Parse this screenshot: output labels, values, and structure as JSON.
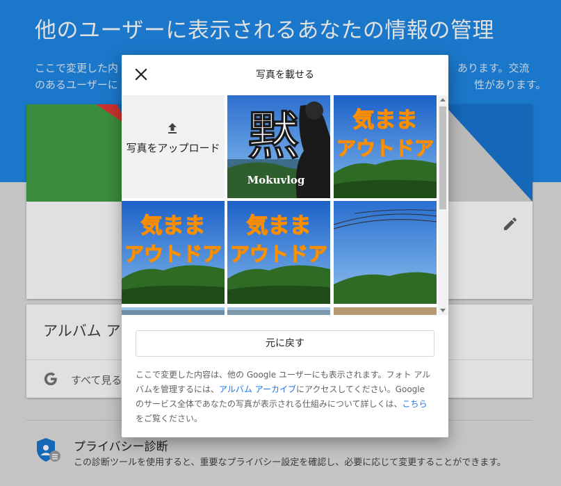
{
  "page": {
    "title": "他のユーザーに表示されるあなたの情報の管理",
    "description_line1_start": "ここで変更した内",
    "description_line1_end": "あります。交流",
    "description_line2_start": "のあるユーザーに",
    "description_line2_end": "性があります。",
    "album_card_title": "アルバム ア",
    "see_all_label": "すべて見る",
    "privacy_title": "プライバシー診断",
    "privacy_description": "この診断ツールを使用すると、重要なプライバシー設定を確認し、必要に応じて変更することができます。"
  },
  "dialog": {
    "title": "写真を載せる",
    "upload_label": "写真をアップロード",
    "restore_button": "元に戻す",
    "notice": {
      "part1": "ここで変更した内容は、他の Google ユーザーにも表示されます。フォト アルバムを管理するには、",
      "album_archive_link": "アルバム アーカイブ",
      "part2": "にアクセスしてください。Google のサービス全体であなたの写真が表示される仕組みについて詳しくは、",
      "here_link": "こちら",
      "part3": "をご覧ください。"
    },
    "photos": [
      {
        "big_text": "黙",
        "sub_text": "Mokuvlog"
      },
      {
        "line1": "気まま",
        "line2": "アウトドア"
      },
      {
        "line1": "気まま",
        "line2": "アウトドア"
      },
      {
        "line1": "気まま",
        "line2": "アウトドア"
      }
    ]
  },
  "colors": {
    "header_blue": "#1e88e5",
    "link_blue": "#1a73e8",
    "badge_yellow": "#ffd600",
    "badge_outline": "#fb8c00"
  },
  "icons": [
    "close-icon",
    "upload-icon",
    "edit-icon",
    "google-g-icon",
    "privacy-shield-icon"
  ]
}
